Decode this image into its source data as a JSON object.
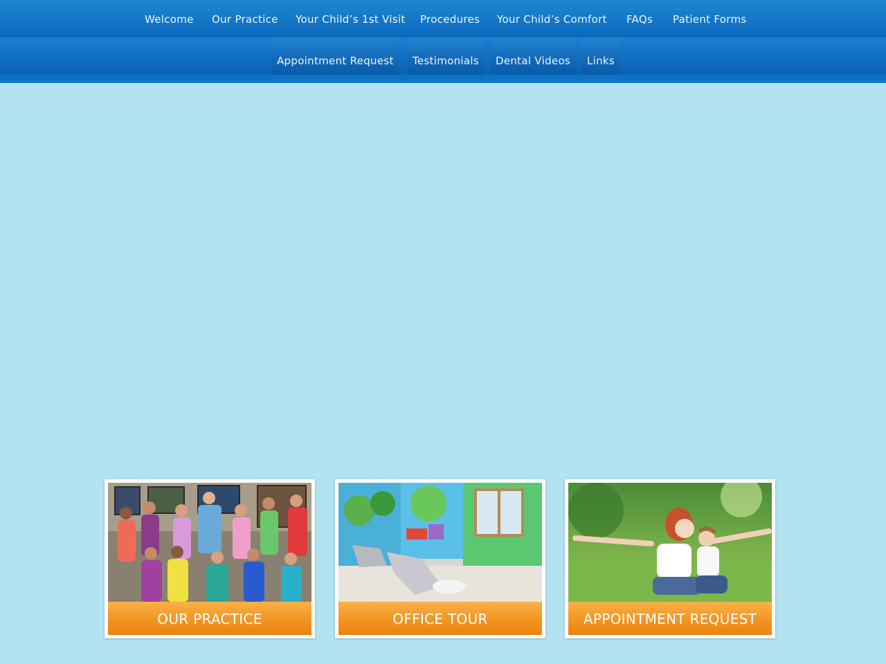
{
  "nav": {
    "row1": [
      "Welcome",
      "Our Practice",
      "Your Child’s 1st Visit",
      "Procedures",
      "Your Child’s Comfort",
      "FAQs",
      "Patient Forms"
    ],
    "row2": [
      "Appointment Request",
      "Testimonials",
      "Dental Videos",
      "Links"
    ]
  },
  "cards": [
    {
      "label": "OUR PRACTICE",
      "image": "team-photo"
    },
    {
      "label": "OFFICE TOUR",
      "image": "dental-office-photo"
    },
    {
      "label": "APPOINTMENT REQUEST",
      "image": "mother-child-photo"
    }
  ],
  "colors": {
    "background": "#b3e3f1",
    "nav": "#0c69bd",
    "button": "#f39521"
  }
}
